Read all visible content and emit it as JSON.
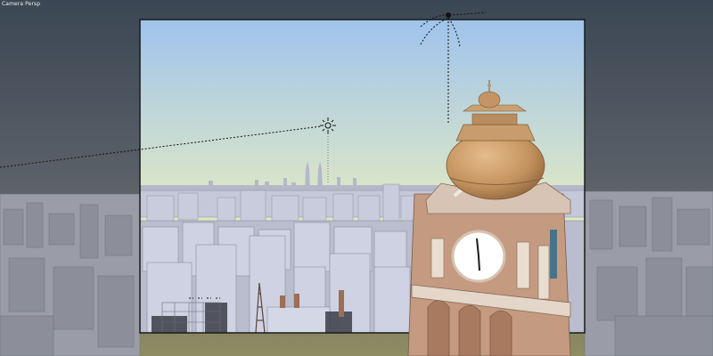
{
  "viewport": {
    "label": "Camera Persp",
    "frame_color": "#1a1a1a",
    "sky_top_color": "#9fc3ec",
    "sky_bottom_color": "#f5f0a8",
    "outer_sky_top_color": "#3e4a56",
    "outer_sky_bottom_color": "#9a9a60",
    "dome_color": "#c99a68",
    "building_color": "#c9ccdc",
    "tower_color": "#c49a80",
    "clock_face_color": "#ffffff"
  },
  "objects": {
    "camera": "camera-object",
    "sun_lamp": "sun-lamp-object",
    "light_target": "light-target-object",
    "clock_tower": "clock-tower",
    "twin_towers": "twin-towers-landmark",
    "radio_mast": "radio-mast"
  }
}
